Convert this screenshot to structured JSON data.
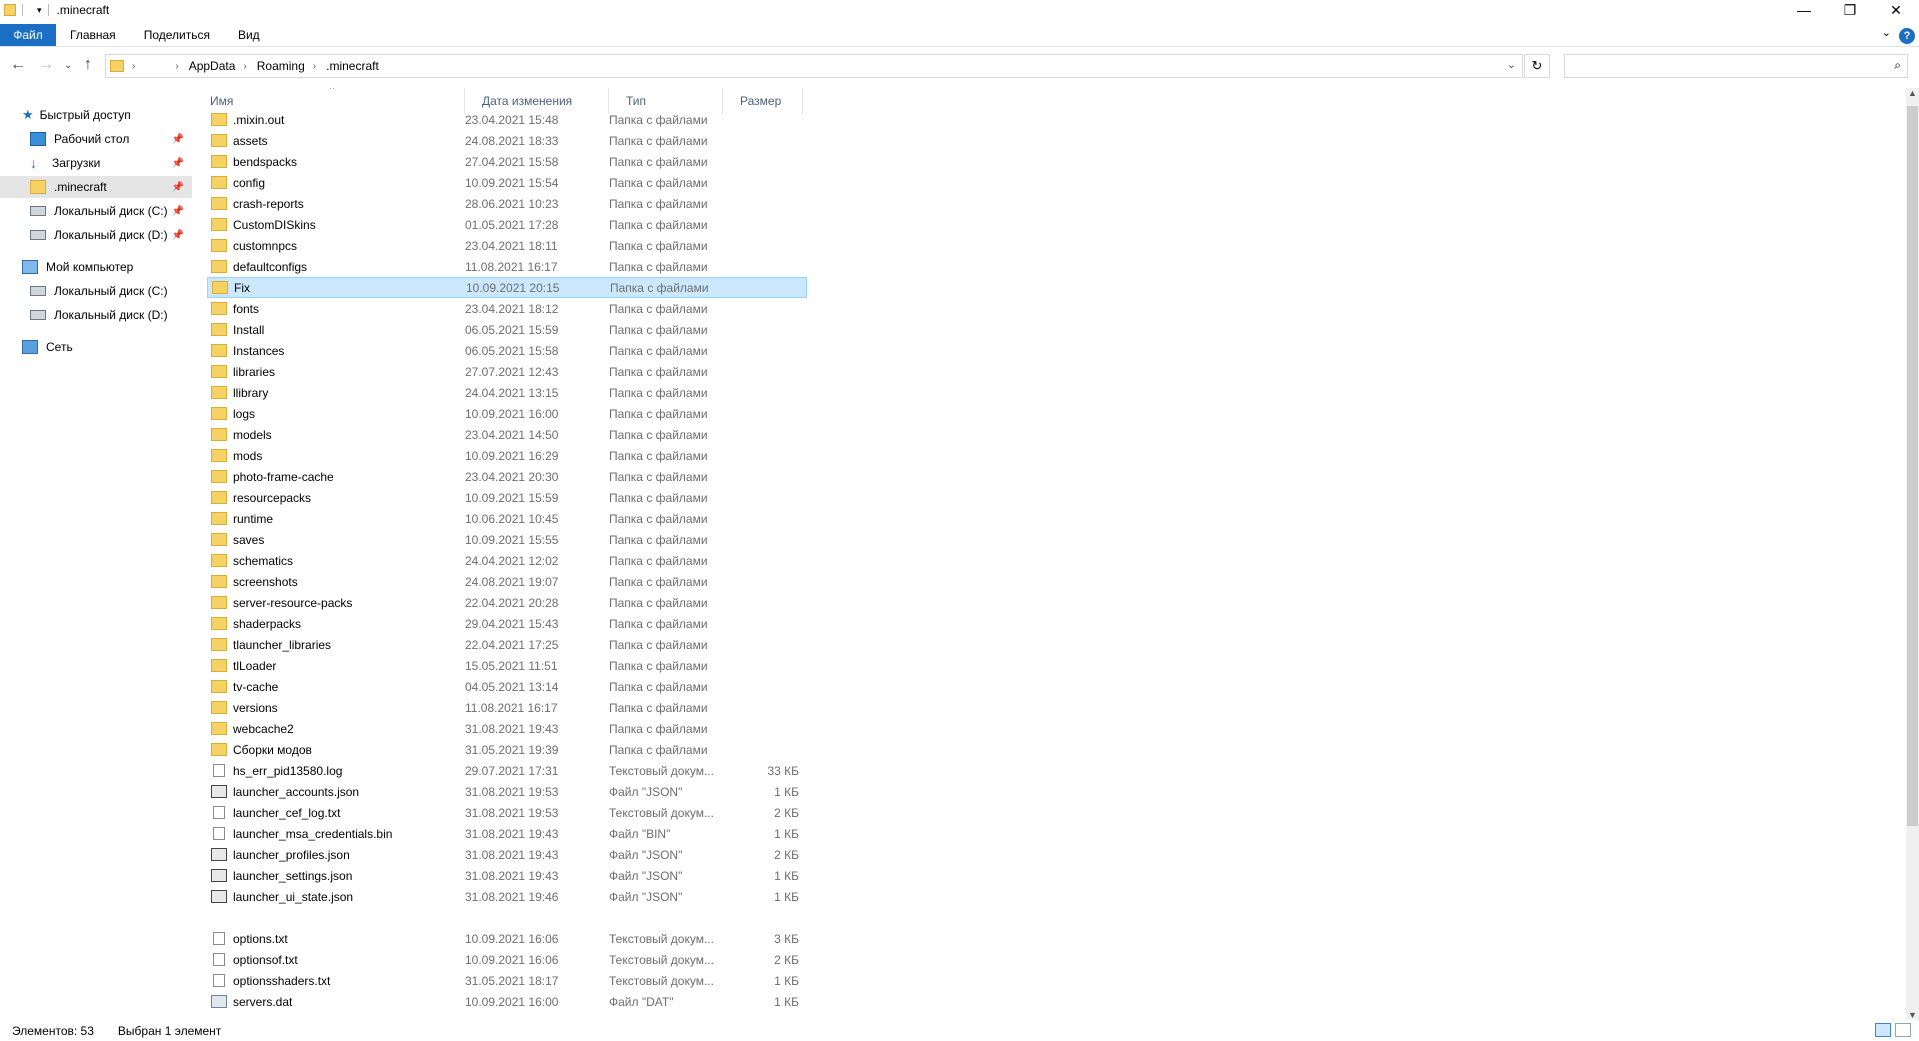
{
  "window": {
    "title": ".minecraft",
    "minimize": "—",
    "maximize": "❐",
    "close": "✕"
  },
  "ribbon": {
    "tabs": [
      "Файл",
      "Главная",
      "Поделиться",
      "Вид"
    ],
    "help": "?"
  },
  "address": {
    "crumbs": [
      "AppData",
      "Roaming",
      ".minecraft"
    ]
  },
  "sidebar": {
    "quick_access": "Быстрый доступ",
    "quick_items": [
      "Рабочий стол",
      "Загрузки",
      ".minecraft",
      "Локальный диск (C:)",
      "Локальный диск (D:)"
    ],
    "computer": "Мой компьютер",
    "computer_items": [
      "Локальный диск (C:)",
      "Локальный диск (D:)"
    ],
    "network": "Сеть"
  },
  "columns": {
    "name": "Имя",
    "date": "Дата изменения",
    "type": "Тип",
    "size": "Размер"
  },
  "files": [
    {
      "name": ".mixin.out",
      "date": "23.04.2021 15:48",
      "type": "Папка с файлами",
      "size": "",
      "icon": "folder"
    },
    {
      "name": "assets",
      "date": "24.08.2021 18:33",
      "type": "Папка с файлами",
      "size": "",
      "icon": "folder"
    },
    {
      "name": "bendspacks",
      "date": "27.04.2021 15:58",
      "type": "Папка с файлами",
      "size": "",
      "icon": "folder"
    },
    {
      "name": "config",
      "date": "10.09.2021 15:54",
      "type": "Папка с файлами",
      "size": "",
      "icon": "folder"
    },
    {
      "name": "crash-reports",
      "date": "28.06.2021 10:23",
      "type": "Папка с файлами",
      "size": "",
      "icon": "folder"
    },
    {
      "name": "CustomDISkins",
      "date": "01.05.2021 17:28",
      "type": "Папка с файлами",
      "size": "",
      "icon": "folder"
    },
    {
      "name": "customnpcs",
      "date": "23.04.2021 18:11",
      "type": "Папка с файлами",
      "size": "",
      "icon": "folder"
    },
    {
      "name": "defaultconfigs",
      "date": "11.08.2021 16:17",
      "type": "Папка с файлами",
      "size": "",
      "icon": "folder"
    },
    {
      "name": "Fix",
      "date": "10.09.2021 20:15",
      "type": "Папка с файлами",
      "size": "",
      "icon": "folder",
      "selected": true
    },
    {
      "name": "fonts",
      "date": "23.04.2021 18:12",
      "type": "Папка с файлами",
      "size": "",
      "icon": "folder"
    },
    {
      "name": "Install",
      "date": "06.05.2021 15:59",
      "type": "Папка с файлами",
      "size": "",
      "icon": "folder"
    },
    {
      "name": "Instances",
      "date": "06.05.2021 15:58",
      "type": "Папка с файлами",
      "size": "",
      "icon": "folder"
    },
    {
      "name": "libraries",
      "date": "27.07.2021 12:43",
      "type": "Папка с файлами",
      "size": "",
      "icon": "folder"
    },
    {
      "name": "llibrary",
      "date": "24.04.2021 13:15",
      "type": "Папка с файлами",
      "size": "",
      "icon": "folder"
    },
    {
      "name": "logs",
      "date": "10.09.2021 16:00",
      "type": "Папка с файлами",
      "size": "",
      "icon": "folder"
    },
    {
      "name": "models",
      "date": "23.04.2021 14:50",
      "type": "Папка с файлами",
      "size": "",
      "icon": "folder"
    },
    {
      "name": "mods",
      "date": "10.09.2021 16:29",
      "type": "Папка с файлами",
      "size": "",
      "icon": "folder"
    },
    {
      "name": "photo-frame-cache",
      "date": "23.04.2021 20:30",
      "type": "Папка с файлами",
      "size": "",
      "icon": "folder"
    },
    {
      "name": "resourcepacks",
      "date": "10.09.2021 15:59",
      "type": "Папка с файлами",
      "size": "",
      "icon": "folder"
    },
    {
      "name": "runtime",
      "date": "10.06.2021 10:45",
      "type": "Папка с файлами",
      "size": "",
      "icon": "folder"
    },
    {
      "name": "saves",
      "date": "10.09.2021 15:55",
      "type": "Папка с файлами",
      "size": "",
      "icon": "folder"
    },
    {
      "name": "schematics",
      "date": "24.04.2021 12:02",
      "type": "Папка с файлами",
      "size": "",
      "icon": "folder"
    },
    {
      "name": "screenshots",
      "date": "24.08.2021 19:07",
      "type": "Папка с файлами",
      "size": "",
      "icon": "folder"
    },
    {
      "name": "server-resource-packs",
      "date": "22.04.2021 20:28",
      "type": "Папка с файлами",
      "size": "",
      "icon": "folder"
    },
    {
      "name": "shaderpacks",
      "date": "29.04.2021 15:43",
      "type": "Папка с файлами",
      "size": "",
      "icon": "folder"
    },
    {
      "name": "tlauncher_libraries",
      "date": "22.04.2021 17:25",
      "type": "Папка с файлами",
      "size": "",
      "icon": "folder"
    },
    {
      "name": "tlLoader",
      "date": "15.05.2021 11:51",
      "type": "Папка с файлами",
      "size": "",
      "icon": "folder"
    },
    {
      "name": "tv-cache",
      "date": "04.05.2021 13:14",
      "type": "Папка с файлами",
      "size": "",
      "icon": "folder"
    },
    {
      "name": "versions",
      "date": "11.08.2021 16:17",
      "type": "Папка с файлами",
      "size": "",
      "icon": "folder"
    },
    {
      "name": "webcache2",
      "date": "31.08.2021 19:43",
      "type": "Папка с файлами",
      "size": "",
      "icon": "folder"
    },
    {
      "name": "Сборки модов",
      "date": "31.05.2021 19:39",
      "type": "Папка с файлами",
      "size": "",
      "icon": "folder"
    },
    {
      "name": "hs_err_pid13580.log",
      "date": "29.07.2021 17:31",
      "type": "Текстовый докум...",
      "size": "33 КБ",
      "icon": "file"
    },
    {
      "name": "launcher_accounts.json",
      "date": "31.08.2021 19:53",
      "type": "Файл \"JSON\"",
      "size": "1 КБ",
      "icon": "json"
    },
    {
      "name": "launcher_cef_log.txt",
      "date": "31.08.2021 19:53",
      "type": "Текстовый докум...",
      "size": "2 КБ",
      "icon": "file"
    },
    {
      "name": "launcher_msa_credentials.bin",
      "date": "31.08.2021 19:43",
      "type": "Файл \"BIN\"",
      "size": "1 КБ",
      "icon": "file"
    },
    {
      "name": "launcher_profiles.json",
      "date": "31.08.2021 19:43",
      "type": "Файл \"JSON\"",
      "size": "2 КБ",
      "icon": "json"
    },
    {
      "name": "launcher_settings.json",
      "date": "31.08.2021 19:43",
      "type": "Файл \"JSON\"",
      "size": "1 КБ",
      "icon": "json"
    },
    {
      "name": "launcher_ui_state.json",
      "date": "31.08.2021 19:46",
      "type": "Файл \"JSON\"",
      "size": "1 КБ",
      "icon": "json"
    },
    {
      "gap": true
    },
    {
      "name": "options.txt",
      "date": "10.09.2021 16:06",
      "type": "Текстовый докум...",
      "size": "3 КБ",
      "icon": "file"
    },
    {
      "name": "optionsof.txt",
      "date": "10.09.2021 16:06",
      "type": "Текстовый докум...",
      "size": "2 КБ",
      "icon": "file"
    },
    {
      "name": "optionsshaders.txt",
      "date": "31.05.2021 18:17",
      "type": "Текстовый докум...",
      "size": "1 КБ",
      "icon": "file"
    },
    {
      "name": "servers.dat",
      "date": "10.09.2021 16:00",
      "type": "Файл \"DAT\"",
      "size": "1 КБ",
      "icon": "dat"
    }
  ],
  "status": {
    "count": "Элементов: 53",
    "selected": "Выбран 1 элемент"
  }
}
